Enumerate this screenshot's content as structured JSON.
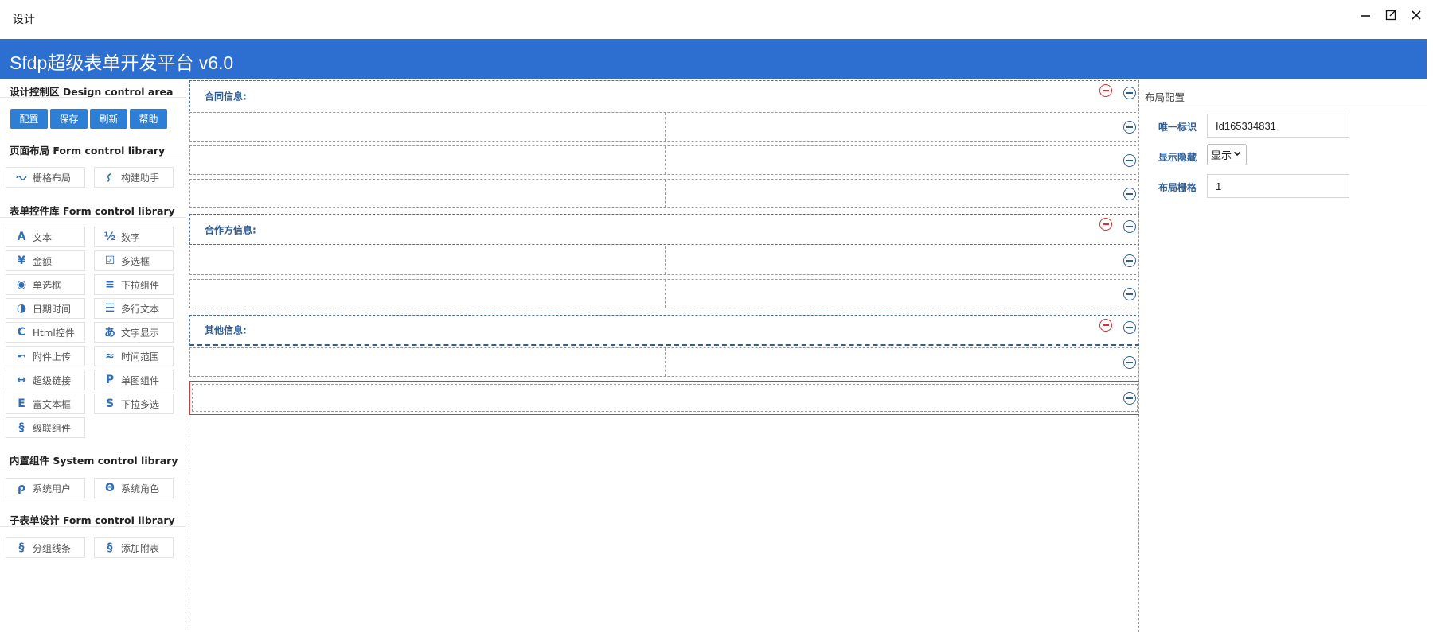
{
  "window": {
    "title": "设计"
  },
  "app": {
    "title": "Sfdp超级表单开发平台 v6.0"
  },
  "sidebar": {
    "design_title": "设计控制区 Design control area",
    "buttons": [
      "配置",
      "保存",
      "刷新",
      "帮助"
    ],
    "layout_title": "页面布局 Form control library",
    "layout_items": [
      {
        "label": "栅格布局",
        "icon": "grid-link-icon"
      },
      {
        "label": "构建助手",
        "icon": "build-helper-icon"
      }
    ],
    "form_title": "表单控件库 Form control library",
    "form_items": [
      {
        "label": "文本",
        "icon": "text-icon",
        "glyph": "A"
      },
      {
        "label": "数字",
        "icon": "number-icon",
        "glyph": "½"
      },
      {
        "label": "金额",
        "icon": "currency-icon",
        "glyph": "¥"
      },
      {
        "label": "多选框",
        "icon": "checkbox-icon",
        "glyph": "☑"
      },
      {
        "label": "单选框",
        "icon": "radio-icon",
        "glyph": "◉"
      },
      {
        "label": "下拉组件",
        "icon": "list-icon",
        "glyph": "≡"
      },
      {
        "label": "日期时间",
        "icon": "half-circle-icon",
        "glyph": "◑"
      },
      {
        "label": "多行文本",
        "icon": "multiline-icon",
        "glyph": "☰"
      },
      {
        "label": "Html控件",
        "icon": "html-icon",
        "glyph": "C"
      },
      {
        "label": "文字显示",
        "icon": "hiragana-icon",
        "glyph": "あ"
      },
      {
        "label": "附件上传",
        "icon": "upload-arrow-icon",
        "glyph": "➸"
      },
      {
        "label": "时间范围",
        "icon": "approx-icon",
        "glyph": "≈"
      },
      {
        "label": "超级链接",
        "icon": "link-arrows-icon",
        "glyph": "↔"
      },
      {
        "label": "单图组件",
        "icon": "image-p-icon",
        "glyph": "P"
      },
      {
        "label": "富文本框",
        "icon": "rich-text-icon",
        "glyph": "E"
      },
      {
        "label": "下拉多选",
        "icon": "multi-select-icon",
        "glyph": "S"
      },
      {
        "label": "级联组件",
        "icon": "section-icon",
        "glyph": "§"
      }
    ],
    "system_title": "内置组件 System control library",
    "system_items": [
      {
        "label": "系统用户",
        "icon": "user-rho-icon",
        "glyph": "ρ"
      },
      {
        "label": "系统角色",
        "icon": "role-theta-icon",
        "glyph": "Θ"
      }
    ],
    "sub_title": "子表单设计 Form control library",
    "sub_items": [
      {
        "label": "分组线条",
        "icon": "section-icon",
        "glyph": "§"
      },
      {
        "label": "添加附表",
        "icon": "section-icon",
        "glyph": "§"
      }
    ]
  },
  "canvas": {
    "groups": [
      "合同信息:",
      "合作方信息:",
      "其他信息:"
    ]
  },
  "props": {
    "title": "布局配置",
    "id_label": "唯一标识",
    "id_value": "Id165334831",
    "visible_label": "显示隐藏",
    "visible_value": "显示",
    "grid_label": "布局栅格",
    "grid_value": "1"
  },
  "colors": {
    "header": "#2d6fd0",
    "button": "#2d7fd6",
    "label": "#2f5f9a",
    "danger": "#d83030"
  }
}
